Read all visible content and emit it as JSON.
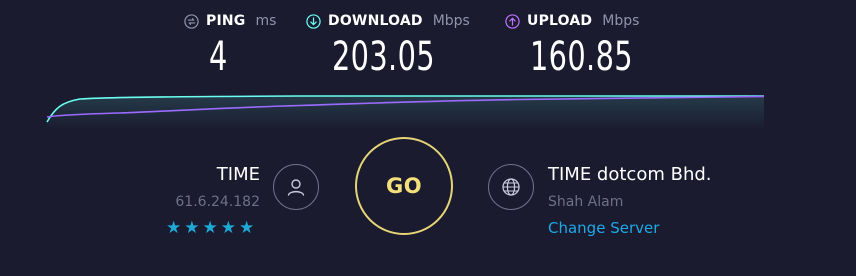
{
  "metrics": {
    "ping": {
      "title": "PING",
      "unit": "ms",
      "value": "4",
      "icon": "ping-icon",
      "color": "#9193a8"
    },
    "download": {
      "title": "DOWNLOAD",
      "unit": "Mbps",
      "value": "203.05",
      "icon": "download-arrow-icon",
      "color": "#6afff3"
    },
    "upload": {
      "title": "UPLOAD",
      "unit": "Mbps",
      "value": "160.85",
      "icon": "upload-arrow-icon",
      "color": "#bf71ff"
    }
  },
  "isp": {
    "name": "TIME",
    "ip": "61.6.24.182",
    "rating_stars": 5,
    "icon": "user-icon"
  },
  "go_button": {
    "label": "GO",
    "color": "#e6d576"
  },
  "server": {
    "name": "TIME dotcom Bhd.",
    "location": "Shah Alam",
    "change_label": "Change Server",
    "icon": "globe-icon"
  },
  "colors": {
    "background": "#1a1b2e",
    "download_line": "#6afff3",
    "upload_line": "#9b6bff",
    "link": "#1ea9e8",
    "star": "#1ea9d6"
  }
}
